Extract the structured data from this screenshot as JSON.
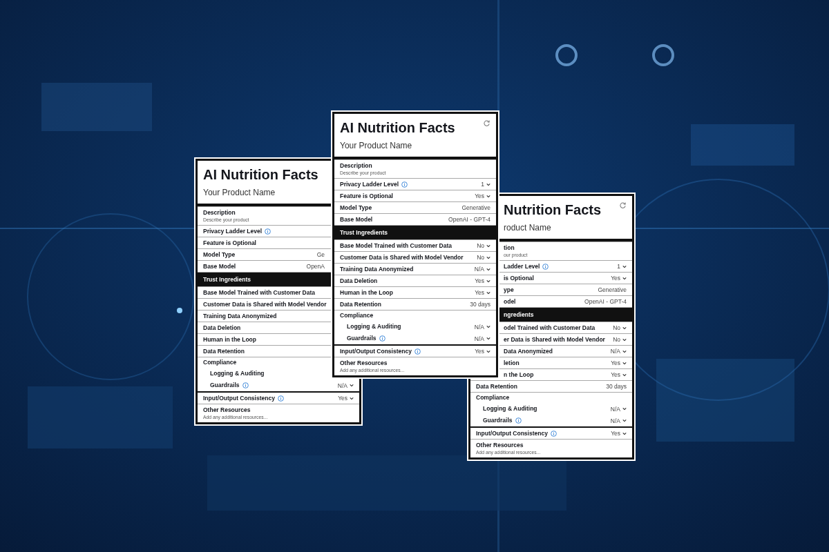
{
  "cards": [
    {
      "title": "AI Nutrition Facts",
      "subtitle": "Your Product Name",
      "reset": false,
      "rows": [
        {
          "kind": "note",
          "label": "Description",
          "hint": "Describe your product"
        },
        {
          "kind": "select",
          "label": "Privacy Ladder Level",
          "info": true
        },
        {
          "kind": "select",
          "label": "Feature is Optional",
          "info": false
        },
        {
          "kind": "fixed",
          "label": "Model Type",
          "value": "Ge"
        },
        {
          "kind": "fixed",
          "label": "Base Model",
          "value": "OpenA"
        },
        {
          "kind": "section",
          "label": "Trust Ingredients"
        },
        {
          "kind": "select",
          "label": "Base Model Trained with Customer Data",
          "info": false
        },
        {
          "kind": "select",
          "label": "Customer Data is Shared with Model Vendor",
          "info": false
        },
        {
          "kind": "select",
          "label": "Training Data Anonymized",
          "info": false
        },
        {
          "kind": "select",
          "label": "Data Deletion",
          "info": false
        },
        {
          "kind": "select",
          "label": "Human in the Loop",
          "info": false
        },
        {
          "kind": "fixed",
          "label": "Data Retention"
        },
        {
          "kind": "group",
          "label": "Compliance",
          "children": [
            {
              "kind": "select",
              "label": "Logging & Auditing",
              "info": false
            },
            {
              "kind": "select",
              "label": "Guardrails",
              "info": true,
              "value": "N/A"
            }
          ]
        },
        {
          "kind": "select",
          "label": "Input/Output Consistency",
          "info": true,
          "value": "Yes"
        },
        {
          "kind": "note",
          "label": "Other Resources",
          "hint": "Add any additional resources..."
        }
      ]
    },
    {
      "title": "AI Nutrition Facts",
      "subtitle": "Your Product Name",
      "reset": true,
      "rows": [
        {
          "kind": "note",
          "label": "Description",
          "hint": "Describe your product"
        },
        {
          "kind": "select",
          "label": "Privacy Ladder Level",
          "info": true,
          "value": "1"
        },
        {
          "kind": "select",
          "label": "Feature is Optional",
          "info": false,
          "value": "Yes"
        },
        {
          "kind": "fixed",
          "label": "Model Type",
          "value": "Generative"
        },
        {
          "kind": "fixed",
          "label": "Base Model",
          "value": "OpenAI - GPT-4"
        },
        {
          "kind": "section",
          "label": "Trust Ingredients"
        },
        {
          "kind": "select",
          "label": "Base Model Trained with Customer Data",
          "info": false,
          "value": "No"
        },
        {
          "kind": "select",
          "label": "Customer Data is Shared with Model Vendor",
          "info": false,
          "value": "No"
        },
        {
          "kind": "select",
          "label": "Training Data Anonymized",
          "info": false,
          "value": "N/A"
        },
        {
          "kind": "select",
          "label": "Data Deletion",
          "info": false,
          "value": "Yes"
        },
        {
          "kind": "select",
          "label": "Human in the Loop",
          "info": false,
          "value": "Yes"
        },
        {
          "kind": "fixed",
          "label": "Data Retention",
          "value": "30 days"
        },
        {
          "kind": "group",
          "label": "Compliance",
          "children": [
            {
              "kind": "select",
              "label": "Logging & Auditing",
              "info": false,
              "value": "N/A"
            },
            {
              "kind": "select",
              "label": "Guardrails",
              "info": true,
              "value": "N/A"
            }
          ]
        },
        {
          "kind": "select",
          "label": "Input/Output Consistency",
          "info": true,
          "value": "Yes"
        },
        {
          "kind": "note",
          "label": "Other Resources",
          "hint": "Add any additional resources..."
        }
      ]
    },
    {
      "title": "Nutrition Facts",
      "subtitle": "roduct Name",
      "reset": true,
      "rows": [
        {
          "kind": "note",
          "label": "tion",
          "hint": "our product"
        },
        {
          "kind": "select",
          "label": "Ladder Level",
          "info": true,
          "value": "1"
        },
        {
          "kind": "select",
          "label": "is Optional",
          "info": false,
          "value": "Yes"
        },
        {
          "kind": "fixed",
          "label": "ype",
          "value": "Generative"
        },
        {
          "kind": "fixed",
          "label": "odel",
          "value": "OpenAI - GPT-4"
        },
        {
          "kind": "section",
          "label": "ngredients"
        },
        {
          "kind": "select",
          "label": "odel Trained with Customer Data",
          "info": false,
          "value": "No"
        },
        {
          "kind": "select",
          "label": "er Data is Shared with Model Vendor",
          "info": false,
          "value": "No"
        },
        {
          "kind": "select",
          "label": "Data Anonymized",
          "info": false,
          "value": "N/A"
        },
        {
          "kind": "select",
          "label": "letion",
          "info": false,
          "value": "Yes"
        },
        {
          "kind": "select",
          "label": "n the Loop",
          "info": false,
          "value": "Yes"
        },
        {
          "kind": "fixed",
          "label": "Data Retention",
          "value": "30 days"
        },
        {
          "kind": "group",
          "label": "Compliance",
          "children": [
            {
              "kind": "select",
              "label": "Logging & Auditing",
              "info": false,
              "value": "N/A"
            },
            {
              "kind": "select",
              "label": "Guardrails",
              "info": true,
              "value": "N/A"
            }
          ]
        },
        {
          "kind": "select",
          "label": "Input/Output Consistency",
          "info": true,
          "value": "Yes"
        },
        {
          "kind": "note",
          "label": "Other Resources",
          "hint": "Add any additional resources..."
        }
      ]
    }
  ]
}
